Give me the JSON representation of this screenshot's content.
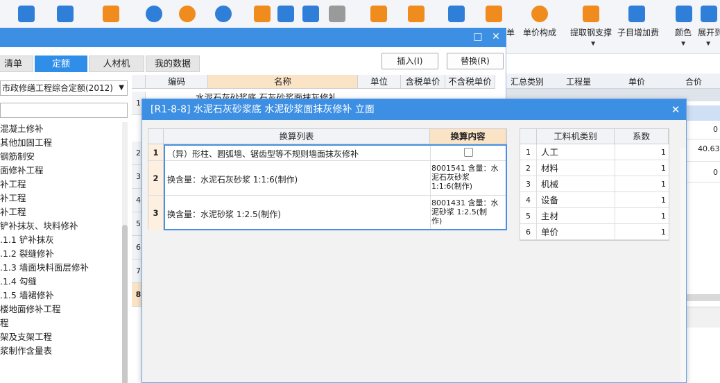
{
  "ribbon": {
    "labels": [
      "单价构成",
      "提取钢支撑",
      "子目增加费",
      "颜色",
      "展开到"
    ],
    "partial_label": "单"
  },
  "background_grid": {
    "headers": [
      "汇总类别",
      "工程量",
      "单价",
      "合价"
    ],
    "values": [
      "0",
      "40.63",
      "0"
    ]
  },
  "window": {
    "maximize_glyph": "□",
    "close_glyph": "✕",
    "tabs": [
      "清单",
      "定额",
      "人材机",
      "我的数据"
    ],
    "insert_button": "插入(I)",
    "replace_button": "替换(R)"
  },
  "left_pane": {
    "dropdown_value": "市政修缮工程综合定额(2012)",
    "tree": [
      "混凝土修补",
      "其他加固工程",
      "钢筋制安",
      "面修补工程",
      "补工程",
      "补工程",
      "补工程",
      "铲补抹灰、块料修补",
      ".1.1 铲补抹灰",
      ".1.2 裂缝修补",
      ".1.3 墙面块料面层修补",
      ".1.4 勾缝",
      ".1.5 墙裙修补",
      "楼地面修补工程",
      "程",
      "架及支架工程",
      "浆制作含量表"
    ]
  },
  "middle_grid": {
    "headers": [
      "编码",
      "名称",
      "单位",
      "含税单价",
      "不含税单价"
    ],
    "first_row_name": "水泥石灰砂浆底 石灰砂浆面抹灰修补",
    "row_numbers": [
      "1",
      "2",
      "3",
      "4",
      "5",
      "6",
      "7",
      "8"
    ]
  },
  "dialog": {
    "title": "[R1-8-8] 水泥石灰砂浆底 水泥砂浆面抹灰修补 立面",
    "close_glyph": "✕",
    "calc_table": {
      "headers": [
        "换算列表",
        "换算内容"
      ],
      "rows": [
        {
          "num": "1",
          "name": "（异）形柱、圆弧墙、锯齿型等不规则墙面抹灰修补",
          "content_line1": "",
          "content_line2": "",
          "content_line3": ""
        },
        {
          "num": "2",
          "name": "换含量：水泥石灰砂浆 1:1:6(制作)",
          "content_line1": "8001541  含量：水",
          "content_line2": "泥石灰砂浆",
          "content_line3": "1:1:6(制作)"
        },
        {
          "num": "3",
          "name": "换含量：水泥砂浆 1:2.5(制作)",
          "content_line1": "8001431  含量：水",
          "content_line2": "泥砂浆 1:2.5(制",
          "content_line3": "作)"
        }
      ]
    },
    "coef_table": {
      "headers": [
        "工料机类别",
        "系数"
      ],
      "rows": [
        {
          "num": "1",
          "name": "人工",
          "value": "1"
        },
        {
          "num": "2",
          "name": "材料",
          "value": "1"
        },
        {
          "num": "3",
          "name": "机械",
          "value": "1"
        },
        {
          "num": "4",
          "name": "设备",
          "value": "1"
        },
        {
          "num": "5",
          "name": "主材",
          "value": "1"
        },
        {
          "num": "6",
          "name": "单价",
          "value": "1"
        }
      ]
    }
  },
  "colors": {
    "title_blue": "#3d8fe4",
    "tab_active": "#2f8ee8",
    "header_highlight": "#fbe3c6",
    "selection_border": "#4a90e2"
  }
}
